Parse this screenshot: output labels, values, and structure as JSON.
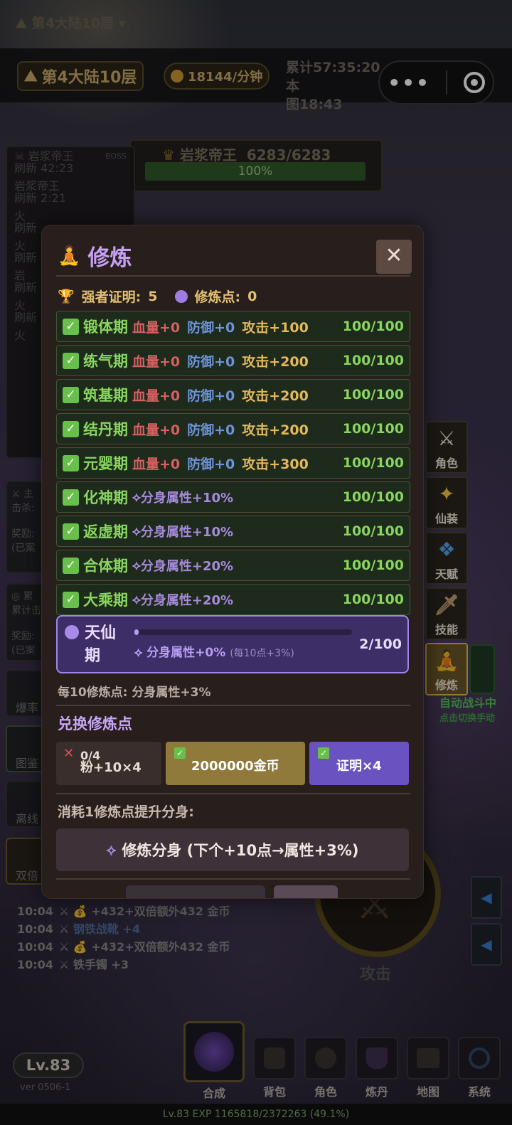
{
  "top": {
    "region_selector": "第4大陆10层",
    "region": "第4大陆10层",
    "gold_rate": "18144/分钟",
    "cumulative": "累计57:35:20 本",
    "map_time": "图18:43"
  },
  "boss": {
    "name": "岩浆帝王",
    "hp": "6283/6283",
    "hp_percent": "100%"
  },
  "left_list": [
    {
      "name": "岩浆帝王",
      "tag": "BOSS",
      "refresh": "刷新 42:23"
    },
    {
      "name": "岩浆帝王",
      "refresh": "刷新 2:21"
    },
    {
      "name": "火",
      "refresh": "刷新"
    },
    {
      "name": "岩"
    }
  ],
  "left_widgets": {
    "quest": "主",
    "kills": "击杀:",
    "reward": "奖励:",
    "claimed": "(已案",
    "total": "累",
    "total_kills": "累计击",
    "drop": "爆率",
    "codex": "图鉴",
    "offline": "离线",
    "double": "双倍"
  },
  "modal": {
    "title": "修炼",
    "proof_label": "强者证明:",
    "proof_value": "5",
    "points_label": "修炼点:",
    "points_value": "0",
    "per_note": "每10修炼点: 分身属性+3%"
  },
  "stages": [
    {
      "name": "锻体期",
      "hp": "血量+0",
      "def": "防御+0",
      "atk": "攻击+100",
      "progress": "100/100"
    },
    {
      "name": "练气期",
      "hp": "血量+0",
      "def": "防御+0",
      "atk": "攻击+200",
      "progress": "100/100"
    },
    {
      "name": "筑基期",
      "hp": "血量+0",
      "def": "防御+0",
      "atk": "攻击+200",
      "progress": "100/100"
    },
    {
      "name": "结丹期",
      "hp": "血量+0",
      "def": "防御+0",
      "atk": "攻击+200",
      "progress": "100/100"
    },
    {
      "name": "元婴期",
      "hp": "血量+0",
      "def": "防御+0",
      "atk": "攻击+300",
      "progress": "100/100"
    },
    {
      "name": "化神期",
      "bonus": "分身属性+10%",
      "progress": "100/100"
    },
    {
      "name": "返虚期",
      "bonus": "分身属性+10%",
      "progress": "100/100"
    },
    {
      "name": "合体期",
      "bonus": "分身属性+20%",
      "progress": "100/100"
    },
    {
      "name": "大乘期",
      "bonus": "分身属性+20%",
      "progress": "100/100"
    }
  ],
  "current_stage": {
    "name": "天仙期",
    "bonus": "分身属性+0%",
    "hint": "(每10点+3%)",
    "progress": "2/100",
    "fill": 0.02
  },
  "exchange": {
    "title": "兑换修炼点",
    "options": [
      {
        "count": "0/4",
        "label": "粉+10×4"
      },
      {
        "label": "2000000金币"
      },
      {
        "label": "证明×4"
      }
    ]
  },
  "consume": {
    "title": "消耗1修炼点提升分身:",
    "button": "修炼分身 (下个+10点→属性+3%)"
  },
  "side_buttons": [
    "角色",
    "仙装",
    "天赋",
    "技能",
    "修炼"
  ],
  "auto_battle": {
    "status": "自动战斗中",
    "hint": "点击切换手动"
  },
  "attack_label": "攻击",
  "logs": [
    {
      "time": "10:04",
      "text": "+432+双倍额外432 金币"
    },
    {
      "time": "10:04",
      "text": "钢铁战靴 +4"
    },
    {
      "time": "10:04",
      "text": "+432+双倍额外432 金币"
    },
    {
      "time": "10:04",
      "text": "铁手镯 +3"
    }
  ],
  "bottom": {
    "level": "Lv.83",
    "version": "ver 0506-1",
    "nav": [
      "合成",
      "背包",
      "角色",
      "炼丹",
      "地图",
      "系统"
    ],
    "exp": "Lv.83  EXP 1165818/2372263 (49.1%)"
  }
}
